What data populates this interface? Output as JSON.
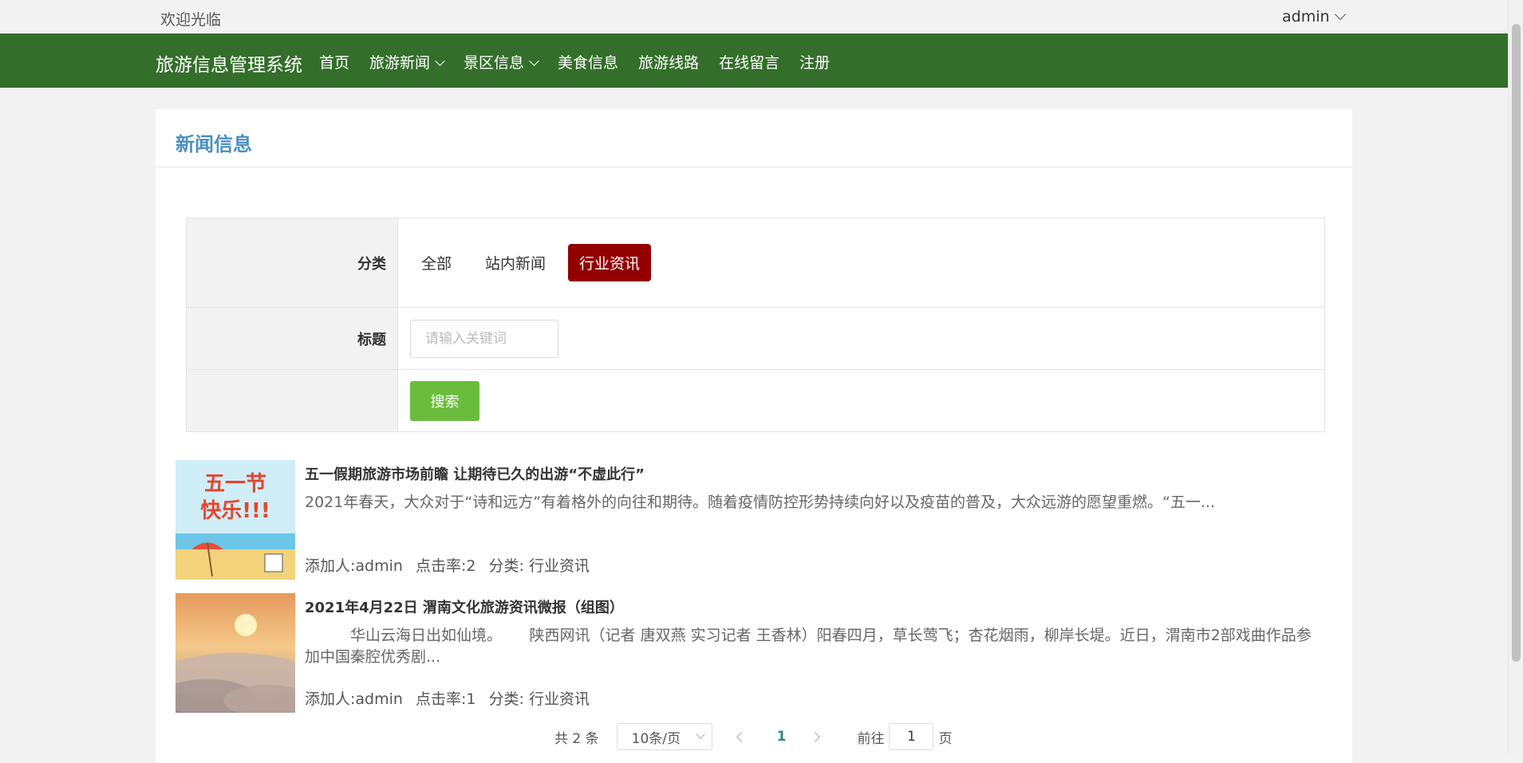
{
  "topbar": {
    "welcome": "欢迎光临",
    "user": "admin"
  },
  "navbar": {
    "brand": "旅游信息管理系统",
    "menu": [
      {
        "label": "首页",
        "dropdown": false
      },
      {
        "label": "旅游新闻",
        "dropdown": true
      },
      {
        "label": "景区信息",
        "dropdown": true
      },
      {
        "label": "美食信息",
        "dropdown": false
      },
      {
        "label": "旅游线路",
        "dropdown": false
      },
      {
        "label": "在线留言",
        "dropdown": false
      },
      {
        "label": "注册",
        "dropdown": false
      }
    ]
  },
  "card": {
    "title": "新闻信息"
  },
  "filter": {
    "category_label": "分类",
    "categories": [
      "全部",
      "站内新闻",
      "行业资讯"
    ],
    "active_category": "行业资讯",
    "title_label": "标题",
    "keyword_placeholder": "请输入关键词",
    "search_button": "搜索"
  },
  "news": [
    {
      "title": "五一假期旅游市场前瞻 让期待已久的出游“不虚此行”",
      "summary": "2021年春天，大众对于“诗和远方”有着格外的向往和期待。随着疫情防控形势持续向好以及疫苗的普及，大众远游的愿望重燃。“五一...",
      "author": "添加人:admin",
      "clicks": "点击率:2",
      "category": "分类: 行业资讯",
      "thumb_text": [
        "五一节",
        "快乐!!!"
      ]
    },
    {
      "title": "2021年4月22日 渭南文化旅游资讯微报（组图）",
      "summary": "　　　华山云海日出如仙境。　　 陕西网讯（记者 唐双燕 实习记者 王香林）阳春四月，草长莺飞；杏花烟雨，柳岸长堤。近日，渭南市2部戏曲作品参加中国秦腔优秀剧...",
      "author": "添加人:admin",
      "clicks": "点击率:1",
      "category": "分类: 行业资讯"
    }
  ],
  "pager": {
    "total": "共 2 条",
    "page_size": "10条/页",
    "current": "1",
    "goto_label": "前往",
    "goto_value": "1",
    "page_unit": "页"
  },
  "colors": {
    "nav_bg": "#346e2b",
    "active_category": "#930000",
    "search_button": "#6abd3c",
    "title": "#4a90c0"
  }
}
